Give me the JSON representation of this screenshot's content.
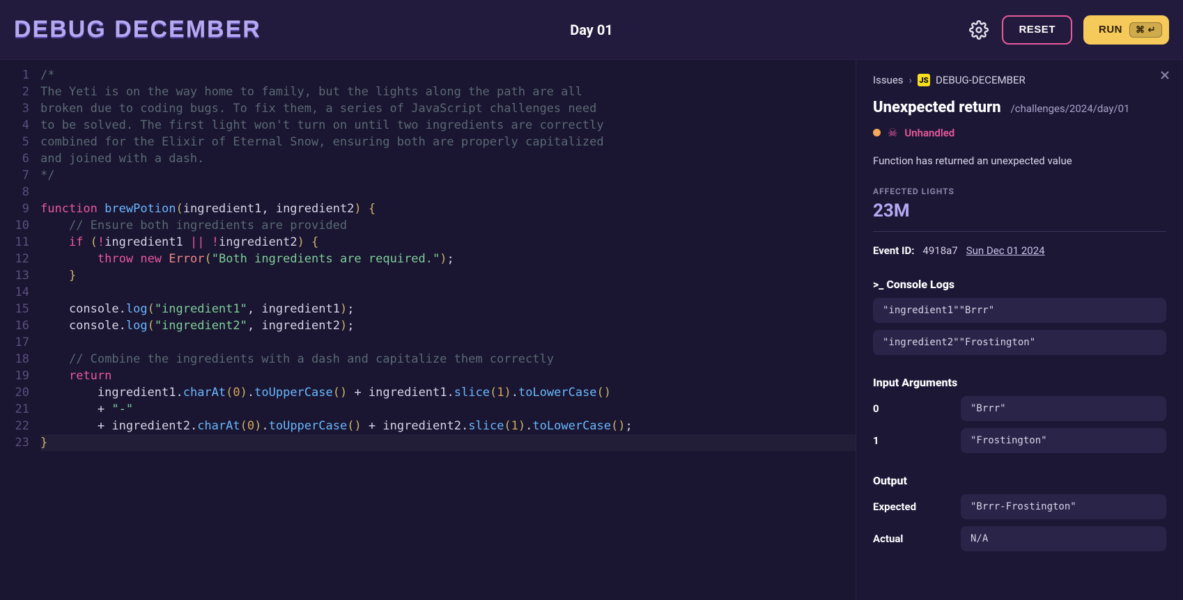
{
  "header": {
    "logo_text": "DEBUG DECEMBER",
    "page_title": "Day 01",
    "reset_label": "RESET",
    "run_label": "RUN",
    "run_shortcut": "⌘ ↵"
  },
  "editor": {
    "line_count": 23,
    "active_line": 23,
    "lines": [
      {
        "n": 1,
        "tokens": [
          {
            "t": "/*",
            "c": "c-comment"
          }
        ]
      },
      {
        "n": 2,
        "tokens": [
          {
            "t": "The Yeti is on the way home to family, but the lights along the path are all",
            "c": "c-comment"
          }
        ]
      },
      {
        "n": 3,
        "tokens": [
          {
            "t": "broken due to coding bugs. To fix them, a series of JavaScript challenges need",
            "c": "c-comment"
          }
        ]
      },
      {
        "n": 4,
        "tokens": [
          {
            "t": "to be solved. The first light won't turn on until two ingredients are correctly",
            "c": "c-comment"
          }
        ]
      },
      {
        "n": 5,
        "tokens": [
          {
            "t": "combined for the Elixir of Eternal Snow, ensuring both are properly capitalized",
            "c": "c-comment"
          }
        ]
      },
      {
        "n": 6,
        "tokens": [
          {
            "t": "and joined with a dash.",
            "c": "c-comment"
          }
        ]
      },
      {
        "n": 7,
        "tokens": [
          {
            "t": "*/",
            "c": "c-comment"
          }
        ]
      },
      {
        "n": 8,
        "tokens": [
          {
            "t": "",
            "c": ""
          }
        ]
      },
      {
        "n": 9,
        "tokens": [
          {
            "t": "function",
            "c": "c-kw"
          },
          {
            "t": " ",
            "c": ""
          },
          {
            "t": "brewPotion",
            "c": "c-fn"
          },
          {
            "t": "(",
            "c": "c-punc"
          },
          {
            "t": "ingredient1",
            "c": "c-ident"
          },
          {
            "t": ", ",
            "c": ""
          },
          {
            "t": "ingredient2",
            "c": "c-ident"
          },
          {
            "t": ")",
            "c": "c-punc"
          },
          {
            "t": " {",
            "c": "c-punc"
          }
        ]
      },
      {
        "n": 10,
        "tokens": [
          {
            "t": "    ",
            "c": ""
          },
          {
            "t": "// Ensure both ingredients are provided",
            "c": "c-comment"
          }
        ]
      },
      {
        "n": 11,
        "tokens": [
          {
            "t": "    ",
            "c": ""
          },
          {
            "t": "if",
            "c": "c-kw"
          },
          {
            "t": " (",
            "c": "c-punc"
          },
          {
            "t": "!",
            "c": "c-kw"
          },
          {
            "t": "ingredient1 ",
            "c": "c-ident"
          },
          {
            "t": "||",
            "c": "c-kw"
          },
          {
            "t": " !",
            "c": "c-kw"
          },
          {
            "t": "ingredient2",
            "c": "c-ident"
          },
          {
            "t": ")",
            "c": "c-punc"
          },
          {
            "t": " {",
            "c": "c-punc"
          }
        ]
      },
      {
        "n": 12,
        "tokens": [
          {
            "t": "        ",
            "c": ""
          },
          {
            "t": "throw",
            "c": "c-kw"
          },
          {
            "t": " ",
            "c": ""
          },
          {
            "t": "new",
            "c": "c-kw"
          },
          {
            "t": " ",
            "c": ""
          },
          {
            "t": "Error",
            "c": "c-err"
          },
          {
            "t": "(",
            "c": "c-punc"
          },
          {
            "t": "\"Both ingredients are required.\"",
            "c": "c-str"
          },
          {
            "t": ")",
            "c": "c-punc"
          },
          {
            "t": ";",
            "c": ""
          }
        ]
      },
      {
        "n": 13,
        "tokens": [
          {
            "t": "    }",
            "c": "c-punc"
          }
        ]
      },
      {
        "n": 14,
        "tokens": [
          {
            "t": "",
            "c": ""
          }
        ]
      },
      {
        "n": 15,
        "tokens": [
          {
            "t": "    console",
            "c": "c-ident"
          },
          {
            "t": ".",
            "c": ""
          },
          {
            "t": "log",
            "c": "c-fn"
          },
          {
            "t": "(",
            "c": "c-punc"
          },
          {
            "t": "\"ingredient1\"",
            "c": "c-str"
          },
          {
            "t": ", ingredient1",
            "c": "c-ident"
          },
          {
            "t": ")",
            "c": "c-punc"
          },
          {
            "t": ";",
            "c": ""
          }
        ]
      },
      {
        "n": 16,
        "tokens": [
          {
            "t": "    console",
            "c": "c-ident"
          },
          {
            "t": ".",
            "c": ""
          },
          {
            "t": "log",
            "c": "c-fn"
          },
          {
            "t": "(",
            "c": "c-punc"
          },
          {
            "t": "\"ingredient2\"",
            "c": "c-str"
          },
          {
            "t": ", ingredient2",
            "c": "c-ident"
          },
          {
            "t": ")",
            "c": "c-punc"
          },
          {
            "t": ";",
            "c": ""
          }
        ]
      },
      {
        "n": 17,
        "tokens": [
          {
            "t": "",
            "c": ""
          }
        ]
      },
      {
        "n": 18,
        "tokens": [
          {
            "t": "    ",
            "c": ""
          },
          {
            "t": "// Combine the ingredients with a dash and capitalize them correctly",
            "c": "c-comment"
          }
        ]
      },
      {
        "n": 19,
        "tokens": [
          {
            "t": "    ",
            "c": ""
          },
          {
            "t": "return",
            "c": "c-kw"
          }
        ]
      },
      {
        "n": 20,
        "tokens": [
          {
            "t": "        ingredient1",
            "c": "c-ident"
          },
          {
            "t": ".",
            "c": ""
          },
          {
            "t": "charAt",
            "c": "c-fn"
          },
          {
            "t": "(",
            "c": "c-punc"
          },
          {
            "t": "0",
            "c": "c-num"
          },
          {
            "t": ")",
            "c": "c-punc"
          },
          {
            "t": ".",
            "c": ""
          },
          {
            "t": "toUpperCase",
            "c": "c-fn"
          },
          {
            "t": "()",
            "c": "c-punc"
          },
          {
            "t": " + ingredient1",
            "c": "c-ident"
          },
          {
            "t": ".",
            "c": ""
          },
          {
            "t": "slice",
            "c": "c-fn"
          },
          {
            "t": "(",
            "c": "c-punc"
          },
          {
            "t": "1",
            "c": "c-num"
          },
          {
            "t": ")",
            "c": "c-punc"
          },
          {
            "t": ".",
            "c": ""
          },
          {
            "t": "toLowerCase",
            "c": "c-fn"
          },
          {
            "t": "()",
            "c": "c-punc"
          }
        ]
      },
      {
        "n": 21,
        "tokens": [
          {
            "t": "        + ",
            "c": "c-ident"
          },
          {
            "t": "\"-\"",
            "c": "c-str"
          }
        ]
      },
      {
        "n": 22,
        "tokens": [
          {
            "t": "        + ingredient2",
            "c": "c-ident"
          },
          {
            "t": ".",
            "c": ""
          },
          {
            "t": "charAt",
            "c": "c-fn"
          },
          {
            "t": "(",
            "c": "c-punc"
          },
          {
            "t": "0",
            "c": "c-num"
          },
          {
            "t": ")",
            "c": "c-punc"
          },
          {
            "t": ".",
            "c": ""
          },
          {
            "t": "toUpperCase",
            "c": "c-fn"
          },
          {
            "t": "()",
            "c": "c-punc"
          },
          {
            "t": " + ingredient2",
            "c": "c-ident"
          },
          {
            "t": ".",
            "c": ""
          },
          {
            "t": "slice",
            "c": "c-fn"
          },
          {
            "t": "(",
            "c": "c-punc"
          },
          {
            "t": "1",
            "c": "c-num"
          },
          {
            "t": ")",
            "c": "c-punc"
          },
          {
            "t": ".",
            "c": ""
          },
          {
            "t": "toLowerCase",
            "c": "c-fn"
          },
          {
            "t": "()",
            "c": "c-punc"
          },
          {
            "t": ";",
            "c": ""
          }
        ]
      },
      {
        "n": 23,
        "tokens": [
          {
            "t": "}",
            "c": "c-punc"
          }
        ]
      }
    ]
  },
  "panel": {
    "crumb_root": "Issues",
    "crumb_project": "DEBUG-DECEMBER",
    "title": "Unexpected return",
    "path": "/challenges/2024/day/01",
    "status_label": "Unhandled",
    "message": "Function has returned an unexpected value",
    "affected_label": "AFFECTED LIGHTS",
    "affected_value": "23M",
    "event_id_label": "Event ID:",
    "event_id_value": "4918a7",
    "event_date": "Sun Dec 01 2024",
    "console_label": ">_ Console Logs",
    "console_logs": [
      "\"ingredient1\"\"Brrr\"",
      "\"ingredient2\"\"Frostington\""
    ],
    "args_label": "Input Arguments",
    "args": [
      {
        "k": "0",
        "v": "\"Brrr\""
      },
      {
        "k": "1",
        "v": "\"Frostington\""
      }
    ],
    "output_label": "Output",
    "output": [
      {
        "k": "Expected",
        "v": "\"Brrr-Frostington\""
      },
      {
        "k": "Actual",
        "v": "N/A"
      }
    ]
  }
}
